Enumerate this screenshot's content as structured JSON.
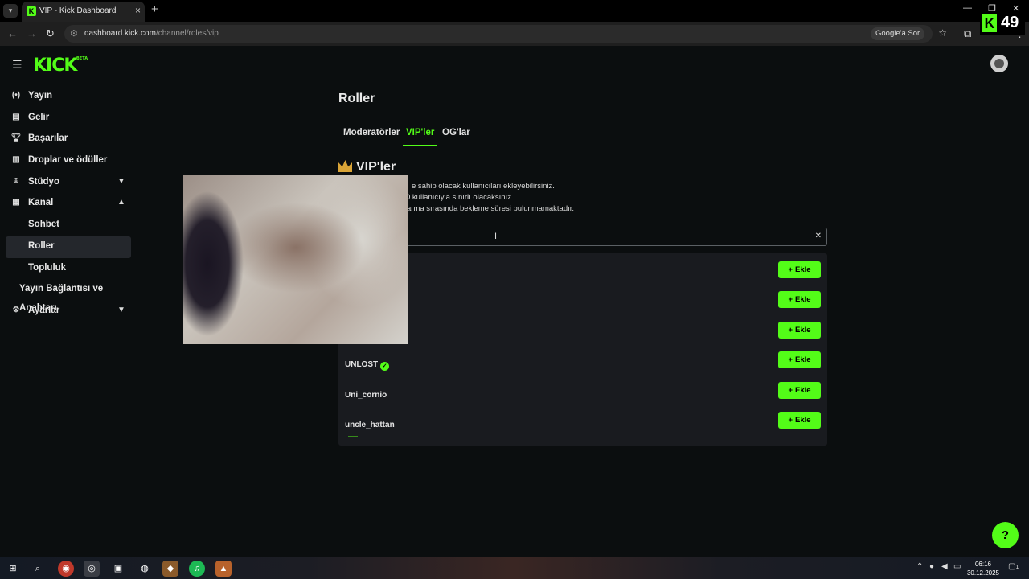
{
  "browser": {
    "tab_title": "VIP - Kick Dashboard",
    "url_host": "dashboard.kick.com",
    "url_path": "/channel/roles/vip",
    "google_ask": "Google'a Sor"
  },
  "overlay_badge": {
    "letter": "K",
    "count": "49"
  },
  "brand": {
    "logo": "KICK",
    "beta": "BETA"
  },
  "sidebar": {
    "items": [
      {
        "label": "Yayın",
        "icon": "broadcast-icon"
      },
      {
        "label": "Gelir",
        "icon": "revenue-icon"
      },
      {
        "label": "Başarılar",
        "icon": "trophy-icon"
      },
      {
        "label": "Droplar ve ödüller",
        "icon": "drops-icon"
      },
      {
        "label": "Stüdyo",
        "icon": "studio-icon"
      },
      {
        "label": "Kanal",
        "icon": "channel-icon"
      },
      {
        "label": "Sohbet"
      },
      {
        "label": "Roller"
      },
      {
        "label": "Topluluk"
      },
      {
        "label": "Yayın Bağlantısı ve Anahtarı"
      },
      {
        "label": "Ayarlar",
        "icon": "settings-icon"
      }
    ]
  },
  "main": {
    "title": "Roller",
    "tabs": [
      "Moderatörler",
      "VIP'ler",
      "OG'lar"
    ],
    "active_tab": "VIP'ler",
    "section_title": "VIP'ler",
    "desc_lines": [
      "e sahip olacak kullanıcıları ekleyebilirsiniz.",
      "0 kullanıcıyla sınırlı olacaksınız.",
      "arma sırasında bekleme süresi bulunmamaktadır."
    ],
    "search_value": "",
    "rows": [
      {
        "name": "",
        "verified": false,
        "action": "Ekle"
      },
      {
        "name": "",
        "verified": false,
        "action": "Ekle"
      },
      {
        "name": "",
        "verified": false,
        "action": "Ekle"
      },
      {
        "name": "UNLOST",
        "verified": true,
        "action": "Ekle"
      },
      {
        "name": "Uni_cornio",
        "verified": false,
        "action": "Ekle"
      },
      {
        "name": "uncle_hattan",
        "verified": false,
        "action": "Ekle"
      }
    ]
  },
  "taskbar": {
    "time": "06:16",
    "date": "30.12.2025",
    "notification_count": "1"
  },
  "colors": {
    "accent": "#53fc18",
    "background": "#0b0e0f",
    "panel": "#191b1f",
    "crown": "#d9a437"
  }
}
